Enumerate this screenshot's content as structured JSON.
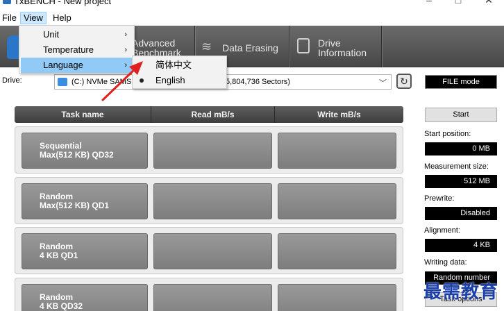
{
  "window": {
    "title": "TxBENCH - New project"
  },
  "menubar": {
    "file": "File",
    "view": "View",
    "help": "Help"
  },
  "toolbar": {
    "advanced_line1": "Advanced",
    "advanced_line2": "Benchmark",
    "erase": "Data Erasing",
    "info_line1": "Drive",
    "info_line2": "Information"
  },
  "view_menu": {
    "items": [
      {
        "label": "Unit",
        "arrow": "›"
      },
      {
        "label": "Temperature",
        "arrow": "›"
      },
      {
        "label": "Language",
        "arrow": "›"
      }
    ]
  },
  "language_menu": {
    "items": [
      {
        "label": "简体中文",
        "selected": false
      },
      {
        "label": "English",
        "selected": true
      }
    ]
  },
  "drive": {
    "label": "Drive:",
    "value_prefix": "(C:) NVMe SAMSU",
    "value_suffix": "5,804,736 Sectors)",
    "file_mode": "FILE mode"
  },
  "table": {
    "headers": {
      "task": "Task name",
      "read": "Read mB/s",
      "write": "Write mB/s"
    },
    "rows": [
      {
        "line1": "Sequential",
        "line2": "Max(512 KB) QD32"
      },
      {
        "line1": "Random",
        "line2": "Max(512 KB) QD1"
      },
      {
        "line1": "Random",
        "line2": "4 KB QD1"
      },
      {
        "line1": "Random",
        "line2": "4 KB QD32"
      }
    ]
  },
  "panel": {
    "start": "Start",
    "start_position_label": "Start position:",
    "start_position": "0 MB",
    "measurement_size_label": "Measurement size:",
    "measurement_size": "512 MB",
    "prewrite_label": "Prewrite:",
    "prewrite": "Disabled",
    "alignment_label": "Alignment:",
    "alignment": "4 KB",
    "writing_data_label": "Writing data:",
    "writing_data": "Random number",
    "task_options": "Task options"
  },
  "watermark": "最需教育",
  "colors": {
    "highlight": "#91c9f7",
    "toolbar": "#565656",
    "arrow": "#e02020",
    "watermark": "#1b3fa8"
  }
}
